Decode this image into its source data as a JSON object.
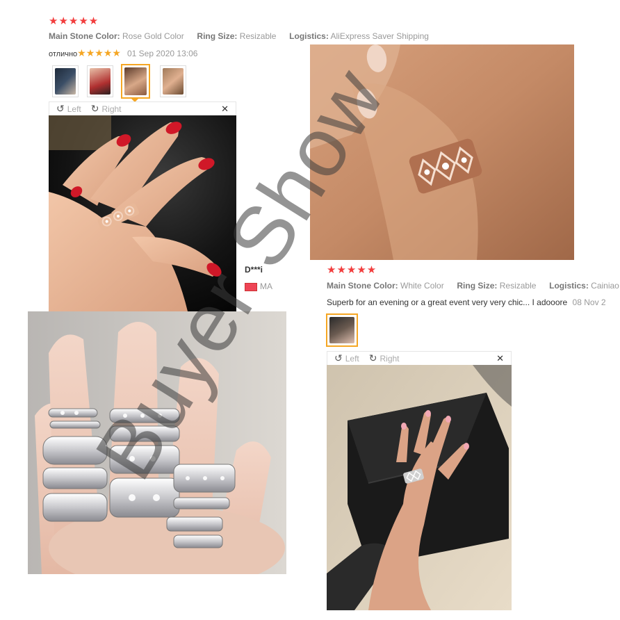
{
  "review1": {
    "stars": "★★★★★",
    "main_stone_label": "Main Stone Color:",
    "main_stone_value": "Rose Gold Color",
    "ring_size_label": "Ring Size:",
    "ring_size_value": "Resizable",
    "logistics_label": "Logistics:",
    "logistics_value": "AliExpress Saver Shipping",
    "feedback_text": "отлично",
    "inline_stars": "★★★★★",
    "date": "01 Sep 2020 13:06"
  },
  "viewer1": {
    "left_label": "Left",
    "right_label": "Right",
    "close_label": "✕"
  },
  "reviewer2": {
    "name": "D***i",
    "country": "MA"
  },
  "review2": {
    "stars": "★★★★★",
    "main_stone_label": "Main Stone Color:",
    "main_stone_value": "White Color",
    "ring_size_label": "Ring Size:",
    "ring_size_value": "Resizable",
    "logistics_label": "Logistics:",
    "logistics_value": "Cainiao Sup",
    "feedback_text": "Superb for an evening or a great event very very chic... I adooore",
    "date": "08 Nov 2"
  },
  "viewer2": {
    "left_label": "Left",
    "right_label": "Right",
    "close_label": "✕"
  },
  "watermark": "Buyer Show",
  "colors": {
    "star_red": "#f23d3d",
    "star_gold": "#f5a623",
    "active_thumb_border": "#f5a623"
  }
}
